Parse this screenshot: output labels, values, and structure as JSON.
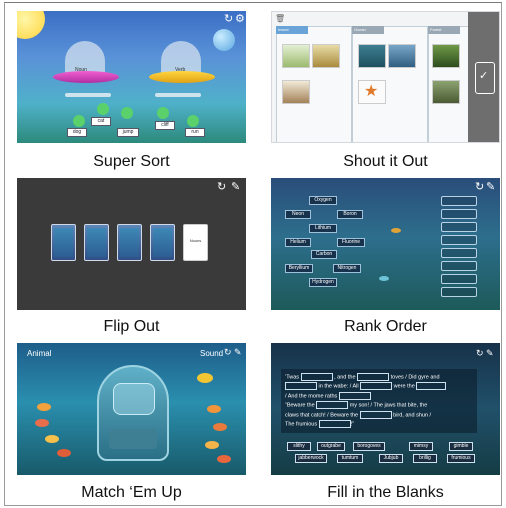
{
  "tiles": [
    {
      "title": "Super Sort",
      "words": [
        "Noun",
        "Verb",
        "cat",
        "dog",
        "jump",
        "cliff",
        "run"
      ]
    },
    {
      "title": "Shout it Out",
      "columns": [
        "Insect",
        "Ocean",
        "Forest"
      ]
    },
    {
      "title": "Flip Out",
      "card_word": "Nouns"
    },
    {
      "title": "Rank Order",
      "words": [
        "Oxygen",
        "Neon",
        "Boron",
        "Lithium",
        "Helium",
        "Fluorine",
        "Carbon",
        "Beryllium",
        "Nitrogen",
        "Hydrogen"
      ]
    },
    {
      "title": "Match ‘Em Up",
      "left_label": "Animal",
      "right_label": "Sound"
    },
    {
      "title": "Fill in the Blanks",
      "passage": [
        "’Twas",
        ", and the",
        "toves / Did gyre and",
        "in the wabe: / All",
        "were the",
        "/ And the mome raths",
        "“Beware the",
        "my son! / The jaws that bite, the",
        "claws that catch! / Beware the",
        "bird, and shun /",
        "The frumious",
        "!”"
      ],
      "bank": [
        "slithy",
        "outgrabe",
        "borogoves",
        "mimsy",
        "gimble",
        "jabberwock",
        "tumtum",
        "Jubjub",
        "brillig",
        "frumious"
      ]
    }
  ],
  "colors": {
    "caption": "#111111",
    "frame": "#9a9a9a"
  }
}
